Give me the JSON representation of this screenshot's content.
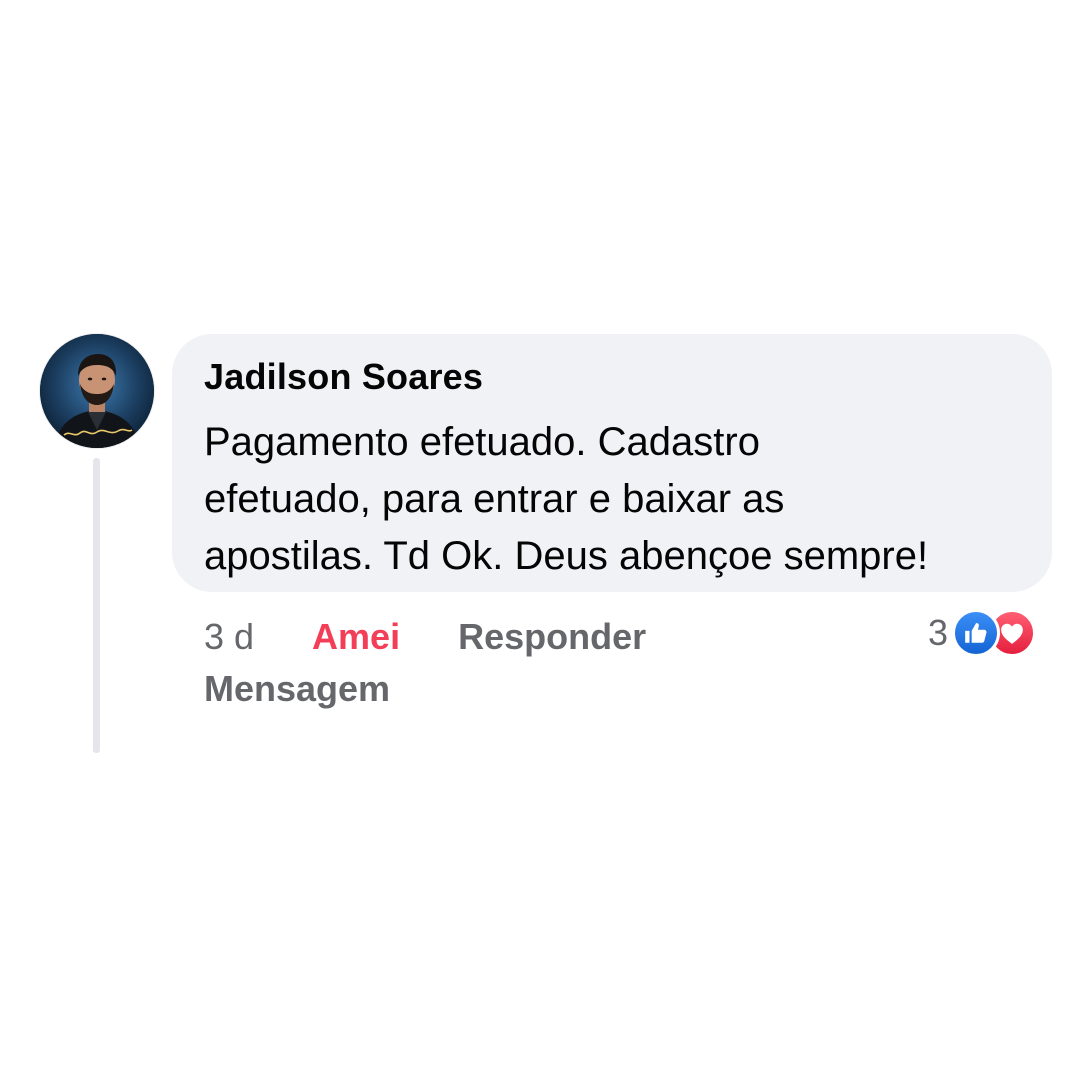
{
  "comment": {
    "author": "Jadilson Soares",
    "body_lines": [
      "Pagamento efetuado. Cadastro",
      "efetuado, para entrar e baixar as",
      "apostilas. Td Ok. Deus abençoe sempre!"
    ],
    "timestamp": "3 d",
    "reaction_label": "Amei",
    "reply_label": "Responder",
    "message_label": "Mensagem",
    "reaction_count": "3",
    "reactions": [
      "like-icon",
      "love-icon"
    ]
  },
  "colors": {
    "bubble_bg": "#f0f2f5",
    "reacted_text": "#f33e58",
    "muted_text": "#65676b",
    "like_blue": "#1877f2",
    "love_red": "#f33e58"
  }
}
